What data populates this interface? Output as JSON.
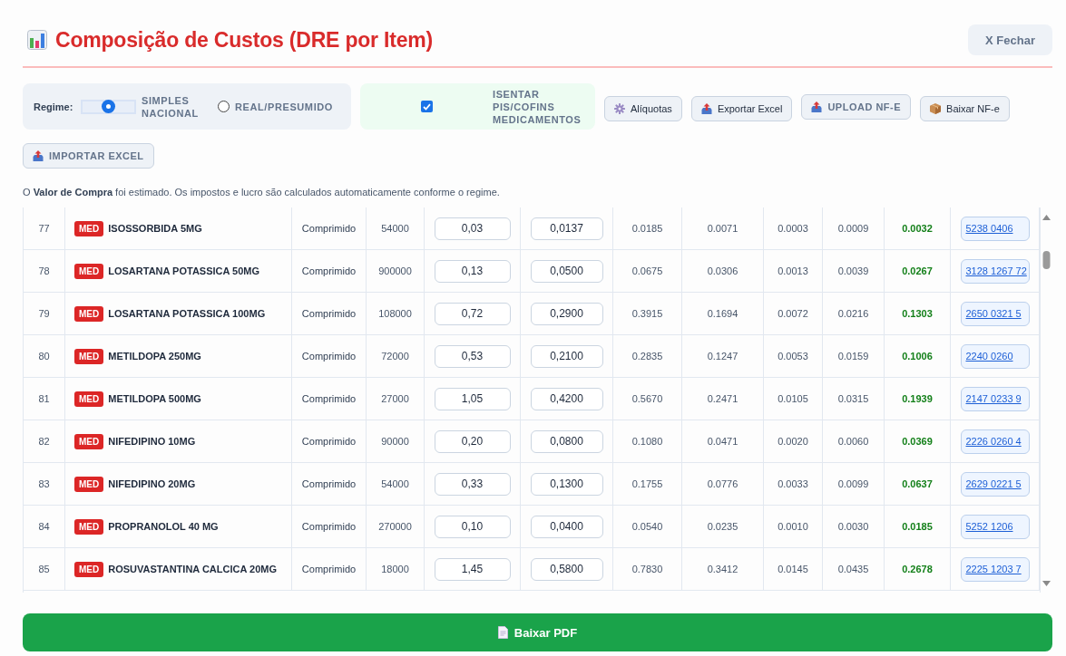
{
  "header": {
    "title": "Composição de Custos (DRE por Item)",
    "close_button": "X Fechar"
  },
  "toolbar": {
    "regime": {
      "label": "Regime:",
      "options": [
        {
          "label": "SIMPLES NACIONAL",
          "selected": true
        },
        {
          "label": "REAL/PRESUMIDO",
          "selected": false
        }
      ]
    },
    "exemption": {
      "label": "ISENTAR PIS/COFINS MEDICAMENTOS",
      "checked": true
    },
    "buttons": [
      {
        "label": "Alíquotas",
        "kind": "settings"
      },
      {
        "label": "Exportar Excel",
        "kind": "export"
      },
      {
        "label": "UPLOAD NF-E",
        "kind": "upload"
      },
      {
        "label": "Baixar NF-e",
        "kind": "download"
      },
      {
        "label": "IMPORTAR EXCEL",
        "kind": "import"
      }
    ]
  },
  "note": "O **Valor de Compra** foi estimado. Os impostos e lucro são calculados automaticamente conforme o regime.",
  "table": {
    "rows": [
      {
        "number": "77",
        "badge": "MED",
        "name": "ISOSSORBIDA 5MG",
        "column_3": "Comprimido",
        "column_4": "54000",
        "column_5": "0,03",
        "column_6": "0,0137",
        "column_7": "0.0185",
        "column_8": "0.0071",
        "column_9": "0.0003",
        "column_10": "0.0009",
        "column_11": "0.0032",
        "column_12": "5238 0406"
      },
      {
        "number": "78",
        "badge": "MED",
        "name": "LOSARTANA POTASSICA 50MG",
        "column_3": "Comprimido",
        "column_4": "900000",
        "column_5": "0,13",
        "column_6": "0,0500",
        "column_7": "0.0675",
        "column_8": "0.0306",
        "column_9": "0.0013",
        "column_10": "0.0039",
        "column_11": "0.0267",
        "column_12": "3128 1267 72"
      },
      {
        "number": "79",
        "badge": "MED",
        "name": "LOSARTANA POTASSICA 100MG",
        "column_3": "Comprimido",
        "column_4": "108000",
        "column_5": "0,72",
        "column_6": "0,2900",
        "column_7": "0.3915",
        "column_8": "0.1694",
        "column_9": "0.0072",
        "column_10": "0.0216",
        "column_11": "0.1303",
        "column_12": "2650 0321 5"
      },
      {
        "number": "80",
        "badge": "MED",
        "name": "METILDOPA 250MG",
        "column_3": "Comprimido",
        "column_4": "72000",
        "column_5": "0,53",
        "column_6": "0,2100",
        "column_7": "0.2835",
        "column_8": "0.1247",
        "column_9": "0.0053",
        "column_10": "0.0159",
        "column_11": "0.1006",
        "column_12": "2240 0260"
      },
      {
        "number": "81",
        "badge": "MED",
        "name": "METILDOPA 500MG",
        "column_3": "Comprimido",
        "column_4": "27000",
        "column_5": "1,05",
        "column_6": "0,4200",
        "column_7": "0.5670",
        "column_8": "0.2471",
        "column_9": "0.0105",
        "column_10": "0.0315",
        "column_11": "0.1939",
        "column_12": "2147 0233 9"
      },
      {
        "number": "82",
        "badge": "MED",
        "name": "NIFEDIPINO 10MG",
        "column_3": "Comprimido",
        "column_4": "90000",
        "column_5": "0,20",
        "column_6": "0,0800",
        "column_7": "0.1080",
        "column_8": "0.0471",
        "column_9": "0.0020",
        "column_10": "0.0060",
        "column_11": "0.0369",
        "column_12": "2226 0260 4"
      },
      {
        "number": "83",
        "badge": "MED",
        "name": "NIFEDIPINO 20MG",
        "column_3": "Comprimido",
        "column_4": "54000",
        "column_5": "0,33",
        "column_6": "0,1300",
        "column_7": "0.1755",
        "column_8": "0.0776",
        "column_9": "0.0033",
        "column_10": "0.0099",
        "column_11": "0.0637",
        "column_12": "2629 0221 5"
      },
      {
        "number": "84",
        "badge": "MED",
        "name": "PROPRANOLOL 40 MG",
        "column_3": "Comprimido",
        "column_4": "270000",
        "column_5": "0,10",
        "column_6": "0,0400",
        "column_7": "0.0540",
        "column_8": "0.0235",
        "column_9": "0.0010",
        "column_10": "0.0030",
        "column_11": "0.0185",
        "column_12": "5252 1206"
      },
      {
        "number": "85",
        "badge": "MED",
        "name": "ROSUVASTANTINA CALCICA 20MG",
        "column_3": "Comprimido",
        "column_4": "18000",
        "column_5": "1,45",
        "column_6": "0,5800",
        "column_7": "0.7830",
        "column_8": "0.3412",
        "column_9": "0.0145",
        "column_10": "0.0435",
        "column_11": "0.2678",
        "column_12": "2225 1203 7"
      }
    ]
  },
  "pdf_button": "Baixar PDF"
}
